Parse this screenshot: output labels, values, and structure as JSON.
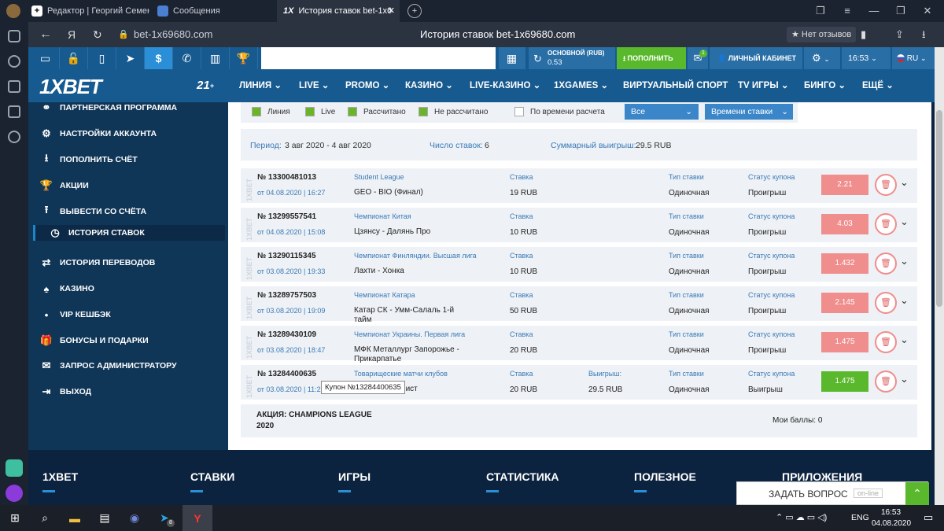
{
  "browser": {
    "tabs": [
      {
        "label": "Редактор | Георгий Семен",
        "active": false
      },
      {
        "label": "Сообщения",
        "active": false
      },
      {
        "label": "История ставок bet-1x6",
        "active": true
      }
    ],
    "address": "bet-1x69680.com",
    "page_title": "История ставок bet-1x69680.com",
    "reviews": "★ Нет отзывов",
    "yandex_letter": "Я"
  },
  "topbar": {
    "balance_label": "ОСНОВНОЙ (RUB)",
    "balance_value": "0.53",
    "deposit_label": "ПОПОЛНИТЬ",
    "mail_badge": "1",
    "cabinet_label": "ЛИЧНЫЙ КАБИНЕТ",
    "time": "16:53",
    "lang": "RU",
    "dollar": "$"
  },
  "nav": {
    "logo": "1XBET",
    "badge": "21",
    "items": [
      "ЛИНИЯ",
      "LIVE",
      "PROMO",
      "КАЗИНО",
      "LIVE-КАЗИНО",
      "1XGAMES",
      "ВИРТУАЛЬНЫЙ СПОРТ",
      "TV ИГРЫ",
      "БИНГО",
      "ЕЩЁ"
    ]
  },
  "sidebar": {
    "items": [
      {
        "icon": "handshake-icon",
        "glyph": "⚭",
        "label": "ПАРТНЕРСКАЯ ПРОГРАММА"
      },
      {
        "icon": "gears-icon",
        "glyph": "⚙",
        "label": "НАСТРОЙКИ АККАУНТА"
      },
      {
        "icon": "download-icon",
        "glyph": "⭳",
        "label": "ПОПОЛНИТЬ СЧЁТ"
      },
      {
        "icon": "trophy-icon",
        "glyph": "🏆",
        "label": "АКЦИИ"
      },
      {
        "icon": "upload-icon",
        "glyph": "⭱",
        "label": "ВЫВЕСТИ СО СЧЁТА"
      },
      {
        "icon": "clock-icon",
        "glyph": "◷",
        "label": "ИСТОРИЯ СТАВОК",
        "selected": true
      },
      {
        "icon": "transfer-icon",
        "glyph": "⇄",
        "label": "ИСТОРИЯ ПЕРЕВОДОВ"
      },
      {
        "icon": "cards-icon",
        "glyph": "♠",
        "label": "КАЗИНО"
      },
      {
        "icon": "dot-icon",
        "glyph": "•",
        "label": "VIP КЕШБЭК"
      },
      {
        "icon": "gift-icon",
        "glyph": "🎁",
        "label": "БОНУСЫ И ПОДАРКИ"
      },
      {
        "icon": "envelope-icon",
        "glyph": "✉",
        "label": "ЗАПРОС АДМИНИСТРАТОРУ"
      },
      {
        "icon": "logout-icon",
        "glyph": "⇥",
        "label": "ВЫХОД"
      }
    ]
  },
  "filters": {
    "checkboxes": [
      {
        "label": "Линия",
        "checked": true
      },
      {
        "label": "Live",
        "checked": true
      },
      {
        "label": "Рассчитано",
        "checked": true
      },
      {
        "label": "Не рассчитано",
        "checked": true
      },
      {
        "label": "По времени расчета",
        "checked": false
      }
    ],
    "select_all": "Все",
    "select_sort": "Времени ставки"
  },
  "summary": {
    "period_label": "Период:",
    "period_value": "3 авг 2020 - 4 авг 2020",
    "count_label": "Число ставок:",
    "count_value": "6",
    "win_label": "Суммарный выигрыш:",
    "win_value": "29.5 RUB"
  },
  "labels": {
    "stake": "Ставка",
    "type": "Тип ставки",
    "status": "Статус купона",
    "winnings": "Выигрыш:",
    "watermark": "1XBET"
  },
  "bets": [
    {
      "num": "№ 13300481013",
      "date": "от 04.08.2020 | 16:27",
      "league": "Student League",
      "match": "GEO - BIO (Финал)",
      "stake": "19 RUB",
      "type": "Одиночная",
      "status": "Проигрыш",
      "coef": "2.21",
      "win": ""
    },
    {
      "num": "№ 13299557541",
      "date": "от 04.08.2020 | 15:08",
      "league": "Чемпионат Китая",
      "match": "Цзянсу - Далянь Про",
      "stake": "10 RUB",
      "type": "Одиночная",
      "status": "Проигрыш",
      "coef": "4.03",
      "win": ""
    },
    {
      "num": "№ 13290115345",
      "date": "от 03.08.2020 | 19:33",
      "league": "Чемпионат Финляндии. Высшая лига",
      "match": "Лахти - Хонка",
      "stake": "10 RUB",
      "type": "Одиночная",
      "status": "Проигрыш",
      "coef": "1.432",
      "win": ""
    },
    {
      "num": "№ 13289757503",
      "date": "от 03.08.2020 | 19:09",
      "league": "Чемпионат Катара",
      "match": "Катар СК - Умм-Салаль 1-й тайм",
      "stake": "50 RUB",
      "type": "Одиночная",
      "status": "Проигрыш",
      "coef": "2.145",
      "win": ""
    },
    {
      "num": "№ 13289430109",
      "date": "от 03.08.2020 | 18:47",
      "league": "Чемпионат Украины. Первая лига",
      "match": "МФК Металлург Запорожье - Прикарпатье",
      "stake": "20 RUB",
      "type": "Одиночная",
      "status": "Проигрыш",
      "coef": "1.475",
      "win": ""
    },
    {
      "num": "№ 13284400635",
      "date": "от 03.08.2020 | 11:2",
      "league": "Товарищеские матчи клубов",
      "match": "в - Автомобилист",
      "stake": "20 RUB",
      "type": "Одиночная",
      "status": "Выигрыш",
      "coef": "1.475",
      "win": "29.5 RUB",
      "won": true
    }
  ],
  "tooltip": "Купон №13284400635",
  "promo": {
    "title_line1": "АКЦИЯ: CHAMPIONS LEAGUE",
    "title_line2": "2020",
    "points": "Мои баллы: 0"
  },
  "footer": {
    "cols": [
      "1XBET",
      "СТАВКИ",
      "ИГРЫ",
      "СТАТИСТИКА",
      "ПОЛЕЗНОЕ",
      "ПРИЛОЖЕНИЯ"
    ]
  },
  "ask": {
    "label": "ЗАДАТЬ ВОПРОС",
    "status": "on-line"
  },
  "taskbar": {
    "lang": "ENG",
    "time": "16:53",
    "date": "04.08.2020",
    "badge": "8"
  },
  "colors": {
    "brand": "#175a8f",
    "lose": "#f08d8d",
    "win": "#59b82c",
    "accent": "#1e86c8"
  }
}
